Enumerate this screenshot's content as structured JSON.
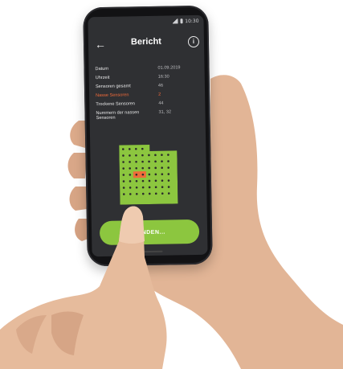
{
  "status_bar": {
    "time": "10:30"
  },
  "header": {
    "back_icon": "arrow-left-icon",
    "title": "Bericht",
    "info_icon": "info-icon"
  },
  "report_rows": [
    {
      "label": "Datum",
      "value": "01.09.2019",
      "highlight": false
    },
    {
      "label": "Uhrzeit",
      "value": "16:30",
      "highlight": false
    },
    {
      "label": "Sensoren gesamt",
      "value": "46",
      "highlight": false
    },
    {
      "label": "Nasse Sensoren",
      "value": "2",
      "highlight": true
    },
    {
      "label": "Trockene Sensoren",
      "value": "44",
      "highlight": false
    },
    {
      "label": "Nummern der nassen Sensoren",
      "value": "31, 32",
      "highlight": false
    }
  ],
  "sensor_map": {
    "dry_color": "#8cc63f",
    "wet_color": "#f06a3a",
    "wet_sensors": [
      31,
      32
    ]
  },
  "send_button": {
    "label": "SENDEN..."
  },
  "colors": {
    "screen_bg": "#2f3033",
    "accent_green": "#8cc63f",
    "accent_orange": "#f06a3a"
  }
}
